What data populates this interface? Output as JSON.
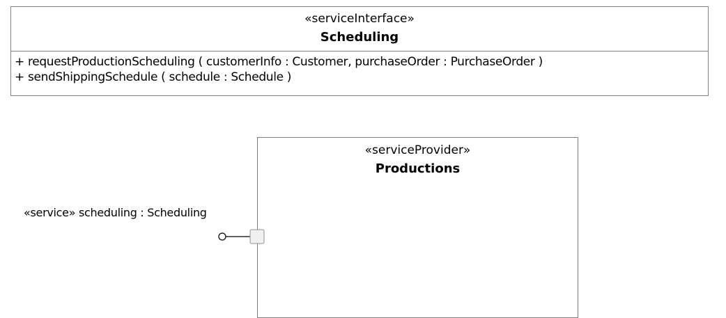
{
  "interface": {
    "stereotype": "«serviceInterface»",
    "name": "Scheduling",
    "operations": [
      "+ requestProductionScheduling ( customerInfo : Customer, purchaseOrder : PurchaseOrder )",
      "+ sendShippingSchedule ( schedule : Schedule )"
    ]
  },
  "component": {
    "stereotype": "«serviceProvider»",
    "name": "Productions"
  },
  "port": {
    "label": "«service» scheduling : Scheduling"
  },
  "colors": {
    "border": "#808080",
    "port_fill": "#f0f0f0"
  }
}
